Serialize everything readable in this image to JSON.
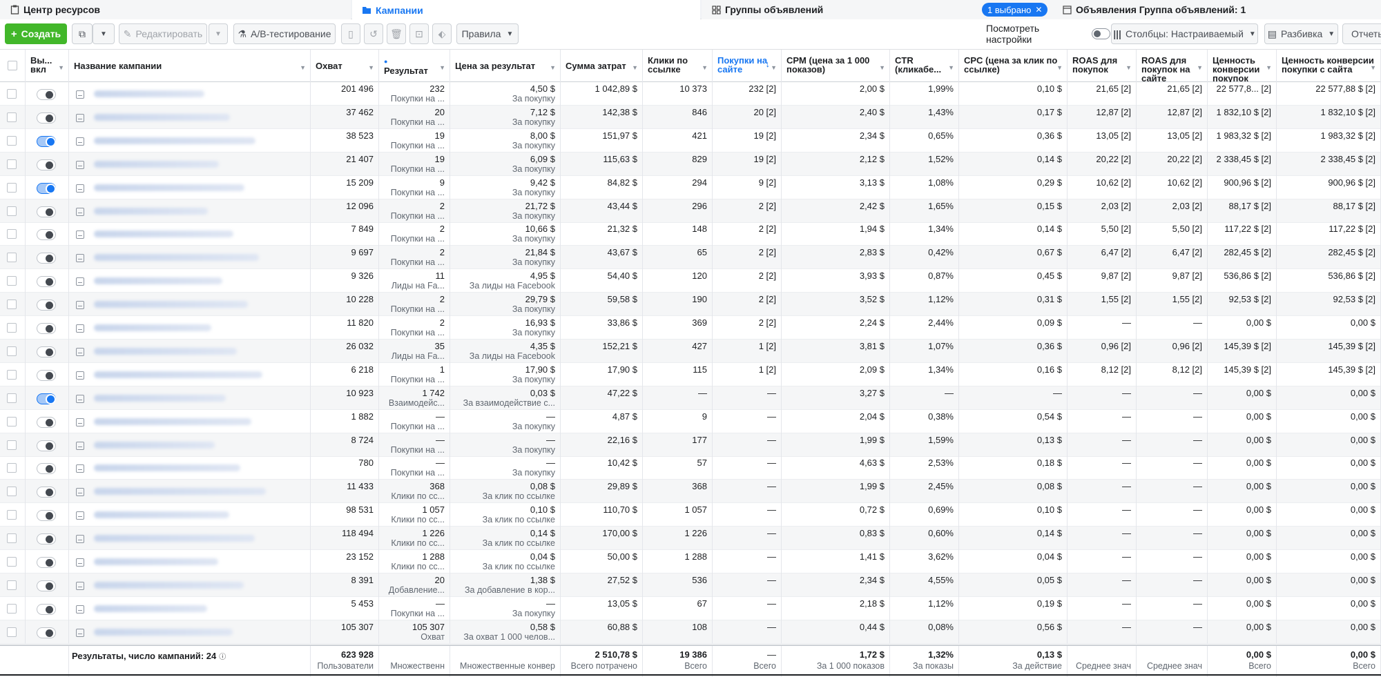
{
  "tabs": {
    "resources": "Центр ресурсов",
    "campaigns": "Кампании",
    "adsets": "Группы объявлений",
    "selected_badge": "1 выбрано",
    "ads": "Объявления Группа объявлений: 1"
  },
  "toolbar": {
    "create": "Создать",
    "edit": "Редактировать",
    "ab_test": "A/B-тестирование",
    "rules": "Правила",
    "view_settings": "Посмотреть настройки",
    "columns": "Столбцы: Настраиваемый",
    "breakdown": "Разбивка",
    "reports": "Отчеты"
  },
  "columns": {
    "onoff": "Вы... вкл",
    "name": "Название кампании",
    "reach": "Охват",
    "result": "Результат",
    "cost_per_result": "Цена за результат",
    "spend": "Сумма затрат",
    "link_clicks": "Клики по ссылке",
    "purchases": "Покупки на сайте",
    "cpm": "CPM (цена за 1 000 показов)",
    "ctr": "CTR (кликабе...",
    "cpc": "CPC (цена за клик по ссылке)",
    "roas": "ROAS для покупок",
    "roas_site": "ROAS для покупок на сайте",
    "conv_value": "Ценность конверсии покупок",
    "conv_value_site": "Ценность конверсии покупки с сайта"
  },
  "rows": [
    {
      "on": false,
      "reach": "201 496",
      "res": "232",
      "res_sub": "Покупки на ...",
      "cpr": "4,50 $",
      "cpr_sub": "За покупку",
      "spend": "1 042,89 $",
      "clicks": "10 373",
      "purch": "232 [2]",
      "cpm": "2,00 $",
      "ctr": "1,99%",
      "cpc": "0,10 $",
      "roas": "21,65 [2]",
      "roas2": "21,65 [2]",
      "cv": "22 577,8... [2]",
      "cv2": "22 577,88 $ [2]"
    },
    {
      "on": false,
      "reach": "37 462",
      "res": "20",
      "res_sub": "Покупки на ...",
      "cpr": "7,12 $",
      "cpr_sub": "За покупку",
      "spend": "142,38 $",
      "clicks": "846",
      "purch": "20 [2]",
      "cpm": "2,40 $",
      "ctr": "1,43%",
      "cpc": "0,17 $",
      "roas": "12,87 [2]",
      "roas2": "12,87 [2]",
      "cv": "1 832,10 $ [2]",
      "cv2": "1 832,10 $ [2]"
    },
    {
      "on": true,
      "reach": "38 523",
      "res": "19",
      "res_sub": "Покупки на ...",
      "cpr": "8,00 $",
      "cpr_sub": "За покупку",
      "spend": "151,97 $",
      "clicks": "421",
      "purch": "19 [2]",
      "cpm": "2,34 $",
      "ctr": "0,65%",
      "cpc": "0,36 $",
      "roas": "13,05 [2]",
      "roas2": "13,05 [2]",
      "cv": "1 983,32 $ [2]",
      "cv2": "1 983,32 $ [2]"
    },
    {
      "on": false,
      "reach": "21 407",
      "res": "19",
      "res_sub": "Покупки на ...",
      "cpr": "6,09 $",
      "cpr_sub": "За покупку",
      "spend": "115,63 $",
      "clicks": "829",
      "purch": "19 [2]",
      "cpm": "2,12 $",
      "ctr": "1,52%",
      "cpc": "0,14 $",
      "roas": "20,22 [2]",
      "roas2": "20,22 [2]",
      "cv": "2 338,45 $ [2]",
      "cv2": "2 338,45 $ [2]"
    },
    {
      "on": true,
      "reach": "15 209",
      "res": "9",
      "res_sub": "Покупки на ...",
      "cpr": "9,42 $",
      "cpr_sub": "За покупку",
      "spend": "84,82 $",
      "clicks": "294",
      "purch": "9 [2]",
      "cpm": "3,13 $",
      "ctr": "1,08%",
      "cpc": "0,29 $",
      "roas": "10,62 [2]",
      "roas2": "10,62 [2]",
      "cv": "900,96 $ [2]",
      "cv2": "900,96 $ [2]"
    },
    {
      "on": false,
      "reach": "12 096",
      "res": "2",
      "res_sub": "Покупки на ...",
      "cpr": "21,72 $",
      "cpr_sub": "За покупку",
      "spend": "43,44 $",
      "clicks": "296",
      "purch": "2 [2]",
      "cpm": "2,42 $",
      "ctr": "1,65%",
      "cpc": "0,15 $",
      "roas": "2,03 [2]",
      "roas2": "2,03 [2]",
      "cv": "88,17 $ [2]",
      "cv2": "88,17 $ [2]"
    },
    {
      "on": false,
      "reach": "7 849",
      "res": "2",
      "res_sub": "Покупки на ...",
      "cpr": "10,66 $",
      "cpr_sub": "За покупку",
      "spend": "21,32 $",
      "clicks": "148",
      "purch": "2 [2]",
      "cpm": "1,94 $",
      "ctr": "1,34%",
      "cpc": "0,14 $",
      "roas": "5,50 [2]",
      "roas2": "5,50 [2]",
      "cv": "117,22 $ [2]",
      "cv2": "117,22 $ [2]"
    },
    {
      "on": false,
      "reach": "9 697",
      "res": "2",
      "res_sub": "Покупки на ...",
      "cpr": "21,84 $",
      "cpr_sub": "За покупку",
      "spend": "43,67 $",
      "clicks": "65",
      "purch": "2 [2]",
      "cpm": "2,83 $",
      "ctr": "0,42%",
      "cpc": "0,67 $",
      "roas": "6,47 [2]",
      "roas2": "6,47 [2]",
      "cv": "282,45 $ [2]",
      "cv2": "282,45 $ [2]"
    },
    {
      "on": false,
      "reach": "9 326",
      "res": "11",
      "res_sub": "Лиды на Fa...",
      "cpr": "4,95 $",
      "cpr_sub": "За лиды на Facebook",
      "spend": "54,40 $",
      "clicks": "120",
      "purch": "2 [2]",
      "cpm": "3,93 $",
      "ctr": "0,87%",
      "cpc": "0,45 $",
      "roas": "9,87 [2]",
      "roas2": "9,87 [2]",
      "cv": "536,86 $ [2]",
      "cv2": "536,86 $ [2]"
    },
    {
      "on": false,
      "reach": "10 228",
      "res": "2",
      "res_sub": "Покупки на ...",
      "cpr": "29,79 $",
      "cpr_sub": "За покупку",
      "spend": "59,58 $",
      "clicks": "190",
      "purch": "2 [2]",
      "cpm": "3,52 $",
      "ctr": "1,12%",
      "cpc": "0,31 $",
      "roas": "1,55 [2]",
      "roas2": "1,55 [2]",
      "cv": "92,53 $ [2]",
      "cv2": "92,53 $ [2]"
    },
    {
      "on": false,
      "reach": "11 820",
      "res": "2",
      "res_sub": "Покупки на ...",
      "cpr": "16,93 $",
      "cpr_sub": "За покупку",
      "spend": "33,86 $",
      "clicks": "369",
      "purch": "2 [2]",
      "cpm": "2,24 $",
      "ctr": "2,44%",
      "cpc": "0,09 $",
      "roas": "—",
      "roas2": "—",
      "cv": "0,00 $",
      "cv2": "0,00 $"
    },
    {
      "on": false,
      "reach": "26 032",
      "res": "35",
      "res_sub": "Лиды на Fa...",
      "cpr": "4,35 $",
      "cpr_sub": "За лиды на Facebook",
      "spend": "152,21 $",
      "clicks": "427",
      "purch": "1 [2]",
      "cpm": "3,81 $",
      "ctr": "1,07%",
      "cpc": "0,36 $",
      "roas": "0,96 [2]",
      "roas2": "0,96 [2]",
      "cv": "145,39 $ [2]",
      "cv2": "145,39 $ [2]"
    },
    {
      "on": false,
      "reach": "6 218",
      "res": "1",
      "res_sub": "Покупки на ...",
      "cpr": "17,90 $",
      "cpr_sub": "За покупку",
      "spend": "17,90 $",
      "clicks": "115",
      "purch": "1 [2]",
      "cpm": "2,09 $",
      "ctr": "1,34%",
      "cpc": "0,16 $",
      "roas": "8,12 [2]",
      "roas2": "8,12 [2]",
      "cv": "145,39 $ [2]",
      "cv2": "145,39 $ [2]"
    },
    {
      "on": true,
      "reach": "10 923",
      "res": "1 742",
      "res_sub": "Взаимодейс...",
      "cpr": "0,03 $",
      "cpr_sub": "За взаимодействие с...",
      "spend": "47,22 $",
      "clicks": "—",
      "purch": "—",
      "cpm": "3,27 $",
      "ctr": "—",
      "cpc": "—",
      "roas": "—",
      "roas2": "—",
      "cv": "0,00 $",
      "cv2": "0,00 $"
    },
    {
      "on": false,
      "reach": "1 882",
      "res": "—",
      "res_sub": "Покупки на ...",
      "cpr": "—",
      "cpr_sub": "За покупку",
      "spend": "4,87 $",
      "clicks": "9",
      "purch": "—",
      "cpm": "2,04 $",
      "ctr": "0,38%",
      "cpc": "0,54 $",
      "roas": "—",
      "roas2": "—",
      "cv": "0,00 $",
      "cv2": "0,00 $"
    },
    {
      "on": false,
      "reach": "8 724",
      "res": "—",
      "res_sub": "Покупки на ...",
      "cpr": "—",
      "cpr_sub": "За покупку",
      "spend": "22,16 $",
      "clicks": "177",
      "purch": "—",
      "cpm": "1,99 $",
      "ctr": "1,59%",
      "cpc": "0,13 $",
      "roas": "—",
      "roas2": "—",
      "cv": "0,00 $",
      "cv2": "0,00 $"
    },
    {
      "on": false,
      "reach": "780",
      "res": "—",
      "res_sub": "Покупки на ...",
      "cpr": "—",
      "cpr_sub": "За покупку",
      "spend": "10,42 $",
      "clicks": "57",
      "purch": "—",
      "cpm": "4,63 $",
      "ctr": "2,53%",
      "cpc": "0,18 $",
      "roas": "—",
      "roas2": "—",
      "cv": "0,00 $",
      "cv2": "0,00 $"
    },
    {
      "on": false,
      "reach": "11 433",
      "res": "368",
      "res_sub": "Клики по сс...",
      "cpr": "0,08 $",
      "cpr_sub": "За клик по ссылке",
      "spend": "29,89 $",
      "clicks": "368",
      "purch": "—",
      "cpm": "1,99 $",
      "ctr": "2,45%",
      "cpc": "0,08 $",
      "roas": "—",
      "roas2": "—",
      "cv": "0,00 $",
      "cv2": "0,00 $"
    },
    {
      "on": false,
      "reach": "98 531",
      "res": "1 057",
      "res_sub": "Клики по сс...",
      "cpr": "0,10 $",
      "cpr_sub": "За клик по ссылке",
      "spend": "110,70 $",
      "clicks": "1 057",
      "purch": "—",
      "cpm": "0,72 $",
      "ctr": "0,69%",
      "cpc": "0,10 $",
      "roas": "—",
      "roas2": "—",
      "cv": "0,00 $",
      "cv2": "0,00 $"
    },
    {
      "on": false,
      "reach": "118 494",
      "res": "1 226",
      "res_sub": "Клики по сс...",
      "cpr": "0,14 $",
      "cpr_sub": "За клик по ссылке",
      "spend": "170,00 $",
      "clicks": "1 226",
      "purch": "—",
      "cpm": "0,83 $",
      "ctr": "0,60%",
      "cpc": "0,14 $",
      "roas": "—",
      "roas2": "—",
      "cv": "0,00 $",
      "cv2": "0,00 $"
    },
    {
      "on": false,
      "reach": "23 152",
      "res": "1 288",
      "res_sub": "Клики по сс...",
      "cpr": "0,04 $",
      "cpr_sub": "За клик по ссылке",
      "spend": "50,00 $",
      "clicks": "1 288",
      "purch": "—",
      "cpm": "1,41 $",
      "ctr": "3,62%",
      "cpc": "0,04 $",
      "roas": "—",
      "roas2": "—",
      "cv": "0,00 $",
      "cv2": "0,00 $"
    },
    {
      "on": false,
      "reach": "8 391",
      "res": "20",
      "res_sub": "Добавление...",
      "cpr": "1,38 $",
      "cpr_sub": "За добавление в кор...",
      "spend": "27,52 $",
      "clicks": "536",
      "purch": "—",
      "cpm": "2,34 $",
      "ctr": "4,55%",
      "cpc": "0,05 $",
      "roas": "—",
      "roas2": "—",
      "cv": "0,00 $",
      "cv2": "0,00 $"
    },
    {
      "on": false,
      "reach": "5 453",
      "res": "—",
      "res_sub": "Покупки на ...",
      "cpr": "—",
      "cpr_sub": "За покупку",
      "spend": "13,05 $",
      "clicks": "67",
      "purch": "—",
      "cpm": "2,18 $",
      "ctr": "1,12%",
      "cpc": "0,19 $",
      "roas": "—",
      "roas2": "—",
      "cv": "0,00 $",
      "cv2": "0,00 $"
    },
    {
      "on": false,
      "reach": "105 307",
      "res": "105 307",
      "res_sub": "Охват",
      "cpr": "0,58 $",
      "cpr_sub": "За охват 1 000 челов...",
      "spend": "60,88 $",
      "clicks": "108",
      "purch": "—",
      "cpm": "0,44 $",
      "ctr": "0,08%",
      "cpc": "0,56 $",
      "roas": "—",
      "roas2": "—",
      "cv": "0,00 $",
      "cv2": "0,00 $"
    }
  ],
  "footer": {
    "label": "Результаты, число кампаний: 24",
    "reach": "623 928",
    "reach_sub": "Пользователи",
    "res_sub": "Множественн",
    "cpr_sub": "Множественные конвер",
    "spend": "2 510,78 $",
    "spend_sub": "Всего потрачено",
    "clicks": "19 386",
    "clicks_sub": "Всего",
    "purch": "—",
    "purch_sub": "Всего",
    "cpm": "1,72 $",
    "cpm_sub": "За 1 000 показов",
    "ctr": "1,32%",
    "ctr_sub": "За показы",
    "cpc": "0,13 $",
    "cpc_sub": "За действие",
    "roas_sub": "Среднее знач",
    "roas2_sub": "Среднее знач",
    "cv": "0,00 $",
    "cv_sub": "Всего",
    "cv2": "0,00 $",
    "cv2_sub": "Всего"
  }
}
